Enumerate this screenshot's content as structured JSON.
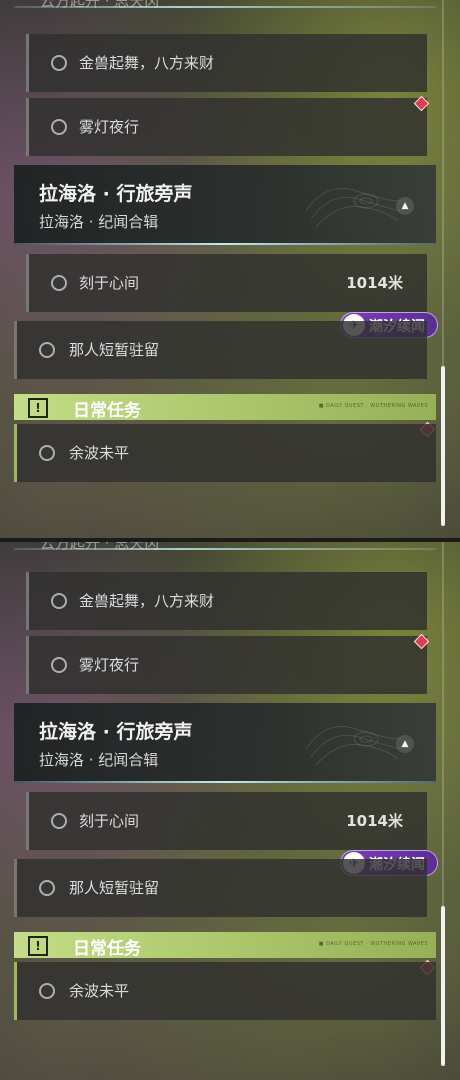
{
  "panels": [
    {
      "cut_off_text": "云方起开 · 思天冈",
      "quests_top": [
        {
          "label": "金兽起舞，八方来财"
        },
        {
          "label": "雾灯夜行"
        }
      ],
      "quest_card": {
        "title": "拉海洛 · 行旅旁声",
        "subtitle": "拉海洛 · 纪闻合辑",
        "arrow_icon": "▲"
      },
      "quests_mid": [
        {
          "label": "刻于心间",
          "distance": "1014米"
        }
      ],
      "quests_main": [
        {
          "label": "那人短暂驻留"
        }
      ],
      "daily": {
        "header": "日常任务",
        "icon": "!",
        "small_text": "■ DAILY QUEST · WUTHERING WAVES"
      },
      "daily_items": [
        {
          "label": "余波未平"
        }
      ],
      "badge": {
        "logo": "✈",
        "text": "潮汐续闻"
      },
      "scrollbar_position": 0.72
    },
    {
      "cut_off_text": "云方起开 · 思天冈",
      "quests_top": [
        {
          "label": "金兽起舞，八方来财"
        },
        {
          "label": "雾灯夜行"
        }
      ],
      "quest_card": {
        "title": "拉海洛 · 行旅旁声",
        "subtitle": "拉海洛 · 纪闻合辑",
        "arrow_icon": "▲"
      },
      "quests_mid": [
        {
          "label": "刻于心间",
          "distance": "1014米"
        }
      ],
      "quests_main": [
        {
          "label": "那人短暂驻留"
        }
      ],
      "daily": {
        "header": "日常任务",
        "icon": "!",
        "small_text": "■ DAILY QUEST · WUTHERING WAVES"
      },
      "daily_items": [
        {
          "label": "余波未平"
        }
      ],
      "badge": {
        "logo": "✈",
        "text": "潮汐续闻"
      },
      "scrollbar_position": 0.72
    }
  ],
  "colors": {
    "accent_green": "#aac56a",
    "marker_red": "#d8404e",
    "badge_purple": "#7b3fb8",
    "glow_cyan": "#c8f5fa"
  }
}
